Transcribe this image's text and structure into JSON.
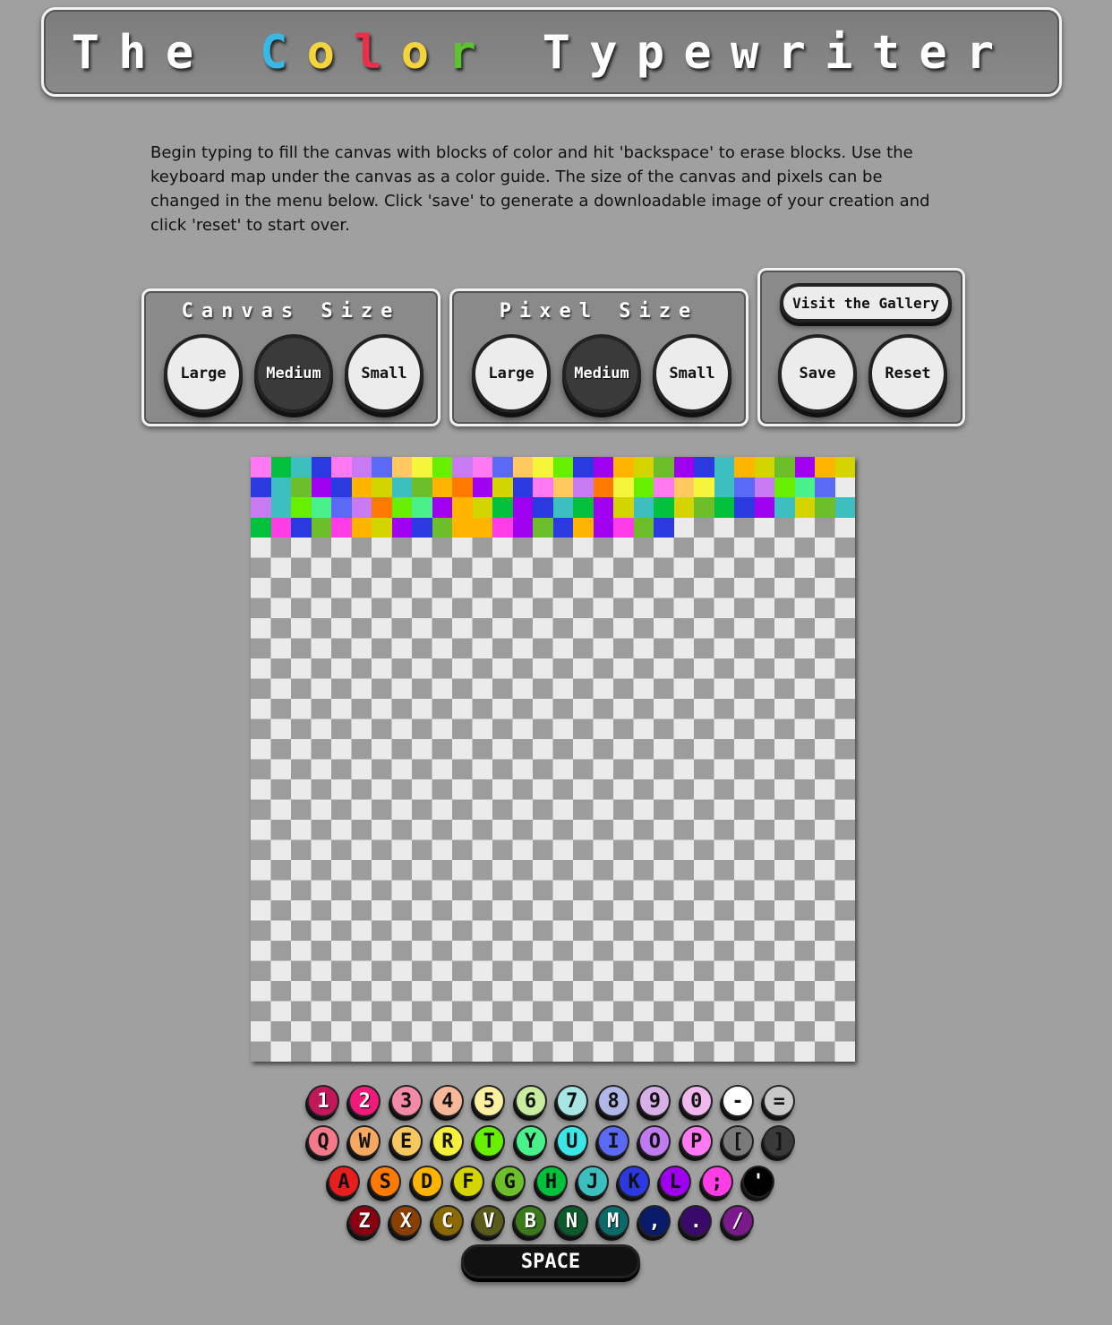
{
  "header": {
    "title_chars": [
      {
        "ch": "T",
        "color": "#ffffff"
      },
      {
        "ch": "h",
        "color": "#ffffff"
      },
      {
        "ch": "e",
        "color": "#ffffff"
      },
      {
        "ch": " ",
        "color": "#ffffff"
      },
      {
        "ch": "C",
        "color": "#3bb7e6"
      },
      {
        "ch": "o",
        "color": "#f5d33a"
      },
      {
        "ch": "l",
        "color": "#e8304a"
      },
      {
        "ch": "o",
        "color": "#f5d33a"
      },
      {
        "ch": "r",
        "color": "#5cc230"
      },
      {
        "ch": " ",
        "color": "#ffffff"
      },
      {
        "ch": "T",
        "color": "#ffffff"
      },
      {
        "ch": "y",
        "color": "#ffffff"
      },
      {
        "ch": "p",
        "color": "#ffffff"
      },
      {
        "ch": "e",
        "color": "#ffffff"
      },
      {
        "ch": "w",
        "color": "#ffffff"
      },
      {
        "ch": "r",
        "color": "#ffffff"
      },
      {
        "ch": "i",
        "color": "#ffffff"
      },
      {
        "ch": "t",
        "color": "#ffffff"
      },
      {
        "ch": "e",
        "color": "#ffffff"
      },
      {
        "ch": "r",
        "color": "#ffffff"
      }
    ]
  },
  "intro": "Begin typing to fill the canvas with blocks of color and hit 'backspace' to erase blocks. Use the keyboard map under the canvas as a color guide. The size of the canvas and pixels can be changed in the menu below. Click 'save' to generate a downloadable image of your creation and click 'reset' to start over.",
  "canvas_size": {
    "title": "Canvas Size",
    "large": "Large",
    "medium": "Medium",
    "small": "Small",
    "selected": "Medium"
  },
  "pixel_size": {
    "title": "Pixel Size",
    "large": "Large",
    "medium": "Medium",
    "small": "Small",
    "selected": "Medium"
  },
  "actions": {
    "gallery": "Visit the Gallery",
    "save": "Save",
    "reset": "Reset"
  },
  "canvas": {
    "columns": 30,
    "rows": [
      [
        "#ff7af2",
        "#00c03c",
        "#3ebfbf",
        "#2a3ae0",
        "#ff7af2",
        "#c77af2",
        "#5a6af5",
        "#ffc860",
        "#f5f53c",
        "#66f000",
        "#c77af2",
        "#ff7af2",
        "#5a6af5",
        "#ffc860",
        "#f5f53c",
        "#66f000",
        "#2a3ae0",
        "#a000f0",
        "#ffb400",
        "#d4d400",
        "#6cbf2a",
        "#a000f0",
        "#2a3ae0",
        "#3ebfbf",
        "#ffb400",
        "#d4d400",
        "#6cbf2a",
        "#a000f0",
        "#ffb400",
        "#d4d400"
      ],
      [
        "#2a3ae0",
        "#3ebfbf",
        "#6cbf2a",
        "#a000f0",
        "#2a3ae0",
        "#ffb400",
        "#d4d400",
        "#3ebfbf",
        "#6cbf2a",
        "#ffb400",
        "#ff7a00",
        "#a000f0",
        "#d4d400",
        "#2a3ae0",
        "#ff7af2",
        "#ffc860",
        "#c77af2",
        "#ff7a00",
        "#f5f53c",
        "#66f000",
        "#ff7af2",
        "#ffc860",
        "#f5f53c",
        "#3ebfbf",
        "#5a6af5",
        "#c77af2",
        "#66f000",
        "#4af08a",
        "#5a6af5",
        "#ffffff00"
      ],
      [
        "#c77af2",
        "#3ebfbf",
        "#66f000",
        "#4af08a",
        "#5a6af5",
        "#c77af2",
        "#ff7a00",
        "#66f000",
        "#4af08a",
        "#a000f0",
        "#ffb400",
        "#d4d400",
        "#00c03c",
        "#a000f0",
        "#2a3ae0",
        "#3ebfbf",
        "#00c03c",
        "#a000f0",
        "#d4d400",
        "#3ebfbf",
        "#00c03c",
        "#d4d400",
        "#6cbf2a",
        "#00c03c",
        "#2a3ae0",
        "#a000f0",
        "#3ebfbf",
        "#d4d400",
        "#6cbf2a",
        "#3ebfbf"
      ],
      [
        "#00c03c",
        "#ff3ce6",
        "#2a3ae0",
        "#6cbf2a",
        "#ff3ce6",
        "#ffb400",
        "#d4d400",
        "#a000f0",
        "#2a3ae0",
        "#6cbf2a",
        "#ffb400",
        "#ffb400",
        "#ff3ce6",
        "#a000f0",
        "#6cbf2a",
        "#2a3ae0",
        "#ffb400",
        "#a000f0",
        "#ff3ce6",
        "#6cbf2a",
        "#2a3ae0"
      ]
    ]
  },
  "keyboard": {
    "rows": [
      [
        {
          "k": "1",
          "c": "#c0185a",
          "l": true
        },
        {
          "k": "2",
          "c": "#f01a7a",
          "l": true
        },
        {
          "k": "3",
          "c": "#f28aa8",
          "l": false
        },
        {
          "k": "4",
          "c": "#f7b89a",
          "l": false
        },
        {
          "k": "5",
          "c": "#fdf0a0",
          "l": false
        },
        {
          "k": "6",
          "c": "#c8eca0",
          "l": false
        },
        {
          "k": "7",
          "c": "#a8e6e6",
          "l": false
        },
        {
          "k": "8",
          "c": "#b0b8e8",
          "l": false
        },
        {
          "k": "9",
          "c": "#d8b0e8",
          "l": false
        },
        {
          "k": "0",
          "c": "#f0b8ee",
          "l": false
        },
        {
          "k": "-",
          "c": "#ffffff",
          "l": false
        },
        {
          "k": "=",
          "c": "#c8c8c8",
          "l": false
        }
      ],
      [
        {
          "k": "Q",
          "c": "#f47a8a",
          "l": false
        },
        {
          "k": "W",
          "c": "#f7a860",
          "l": false
        },
        {
          "k": "E",
          "c": "#f7c860",
          "l": false
        },
        {
          "k": "R",
          "c": "#f5f03c",
          "l": false
        },
        {
          "k": "T",
          "c": "#66f000",
          "l": false
        },
        {
          "k": "Y",
          "c": "#4af08a",
          "l": false
        },
        {
          "k": "U",
          "c": "#3ce6e6",
          "l": false
        },
        {
          "k": "I",
          "c": "#5a6af5",
          "l": false
        },
        {
          "k": "O",
          "c": "#c07af2",
          "l": false
        },
        {
          "k": "P",
          "c": "#ff7af2",
          "l": false
        },
        {
          "k": "[",
          "c": "#7a7a7a",
          "l": false
        },
        {
          "k": "]",
          "c": "#3a3a3a",
          "l": false
        }
      ],
      [
        {
          "k": "A",
          "c": "#e81e1e",
          "l": false
        },
        {
          "k": "S",
          "c": "#ff7a00",
          "l": false
        },
        {
          "k": "D",
          "c": "#ffb400",
          "l": false
        },
        {
          "k": "F",
          "c": "#d4d400",
          "l": false
        },
        {
          "k": "G",
          "c": "#6cbf2a",
          "l": false
        },
        {
          "k": "H",
          "c": "#00c03c",
          "l": false
        },
        {
          "k": "J",
          "c": "#3ebfbf",
          "l": false
        },
        {
          "k": "K",
          "c": "#2a3ae0",
          "l": false
        },
        {
          "k": "L",
          "c": "#a000f0",
          "l": false
        },
        {
          "k": ";",
          "c": "#ff3ce6",
          "l": false
        },
        {
          "k": "'",
          "c": "#000000",
          "l": true
        }
      ],
      [
        {
          "k": "Z",
          "c": "#8a0010",
          "l": true
        },
        {
          "k": "X",
          "c": "#8a4000",
          "l": true
        },
        {
          "k": "C",
          "c": "#8a6a00",
          "l": true
        },
        {
          "k": "V",
          "c": "#5a5a1a",
          "l": true
        },
        {
          "k": "B",
          "c": "#3a7a1a",
          "l": true
        },
        {
          "k": "N",
          "c": "#0a5a2a",
          "l": true
        },
        {
          "k": "M",
          "c": "#0a6a6a",
          "l": true
        },
        {
          "k": ",",
          "c": "#0a1a6a",
          "l": true
        },
        {
          "k": ".",
          "c": "#3a0a6a",
          "l": true
        },
        {
          "k": "/",
          "c": "#7a1a8a",
          "l": true
        }
      ]
    ],
    "space": "SPACE"
  }
}
